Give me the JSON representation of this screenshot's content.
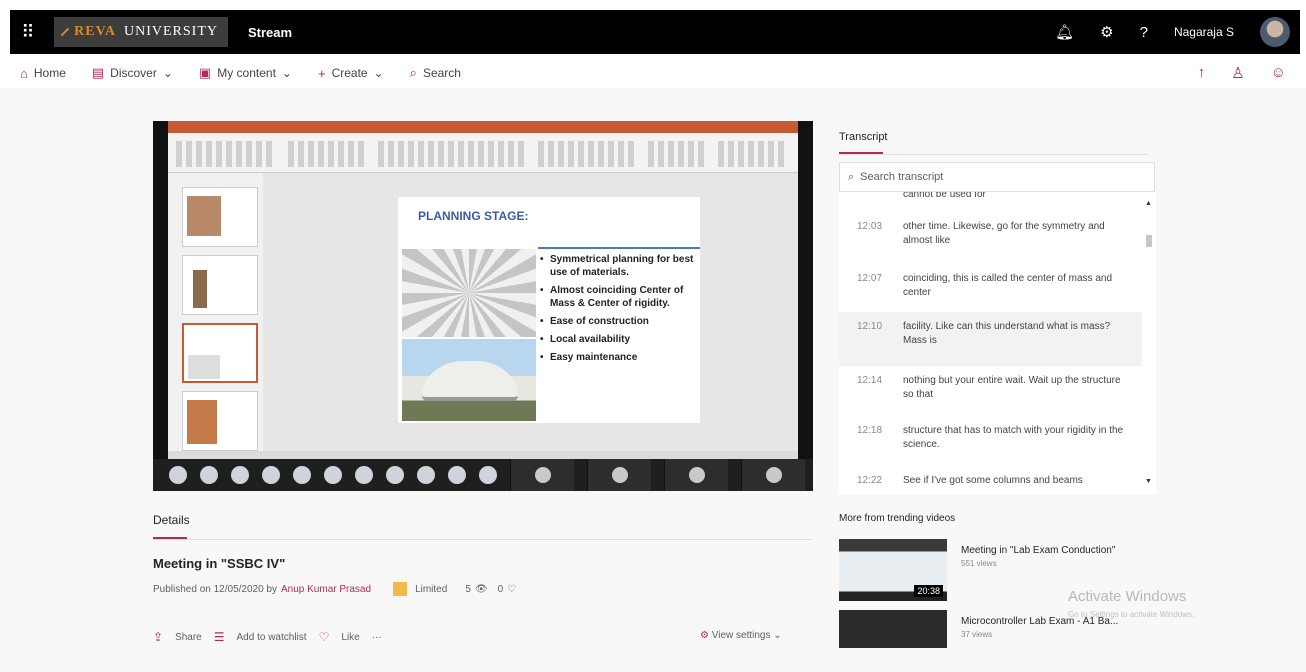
{
  "app": {
    "org_name_1": "REVA",
    "org_name_2": "UNIVERSITY",
    "product": "Stream",
    "user_name": "Nagaraja S"
  },
  "nav": {
    "home": "Home",
    "discover": "Discover",
    "my_content": "My content",
    "create": "Create",
    "search": "Search"
  },
  "slide": {
    "title": "PLANNING STAGE:",
    "bullets": [
      "Symmetrical planning for best use of materials.",
      "Almost coinciding Center of Mass & Center of rigidity.",
      "Ease of construction",
      "Local availability",
      "Easy maintenance"
    ]
  },
  "details": {
    "tab": "Details",
    "video_title": "Meeting in \"SSBC IV\"",
    "published_prefix": "Published on 12/05/2020 by",
    "author": "Anup Kumar Prasad",
    "visibility": "Limited",
    "views": "5",
    "likes": "0",
    "actions": {
      "share": "Share",
      "watchlist": "Add to watchlist",
      "like": "Like",
      "more": "···"
    },
    "view_settings": "View settings"
  },
  "transcript": {
    "title": "Transcript",
    "search_placeholder": "Search transcript",
    "top_partial": "cannot be used for",
    "rows": [
      {
        "time": "12:03",
        "text": "other time. Likewise, go for the symmetry and almost like"
      },
      {
        "time": "12:07",
        "text": "coinciding, this is called the center of mass and center"
      },
      {
        "time": "12:10",
        "text": "facility. Like can this understand what is mass? Mass is"
      },
      {
        "time": "12:14",
        "text": "nothing but your entire wait. Wait up the structure so that"
      },
      {
        "time": "12:18",
        "text": "structure that has to match with your rigidity in the science."
      },
      {
        "time": "12:22",
        "text": "See if I've got some columns and beams"
      }
    ]
  },
  "trending": {
    "title": "More from trending videos",
    "items": [
      {
        "title": "Meeting in \"Lab Exam Conduction\"",
        "views": "551 views",
        "duration": "20:38"
      },
      {
        "title": "Microcontroller Lab Exam - A1 Ba...",
        "views": "37 views"
      }
    ]
  },
  "watermark": {
    "line1": "Activate Windows",
    "line2": "Go to Settings to activate Windows."
  },
  "colors": {
    "accent": "#b22a5b",
    "brand": "#d88a2b"
  }
}
